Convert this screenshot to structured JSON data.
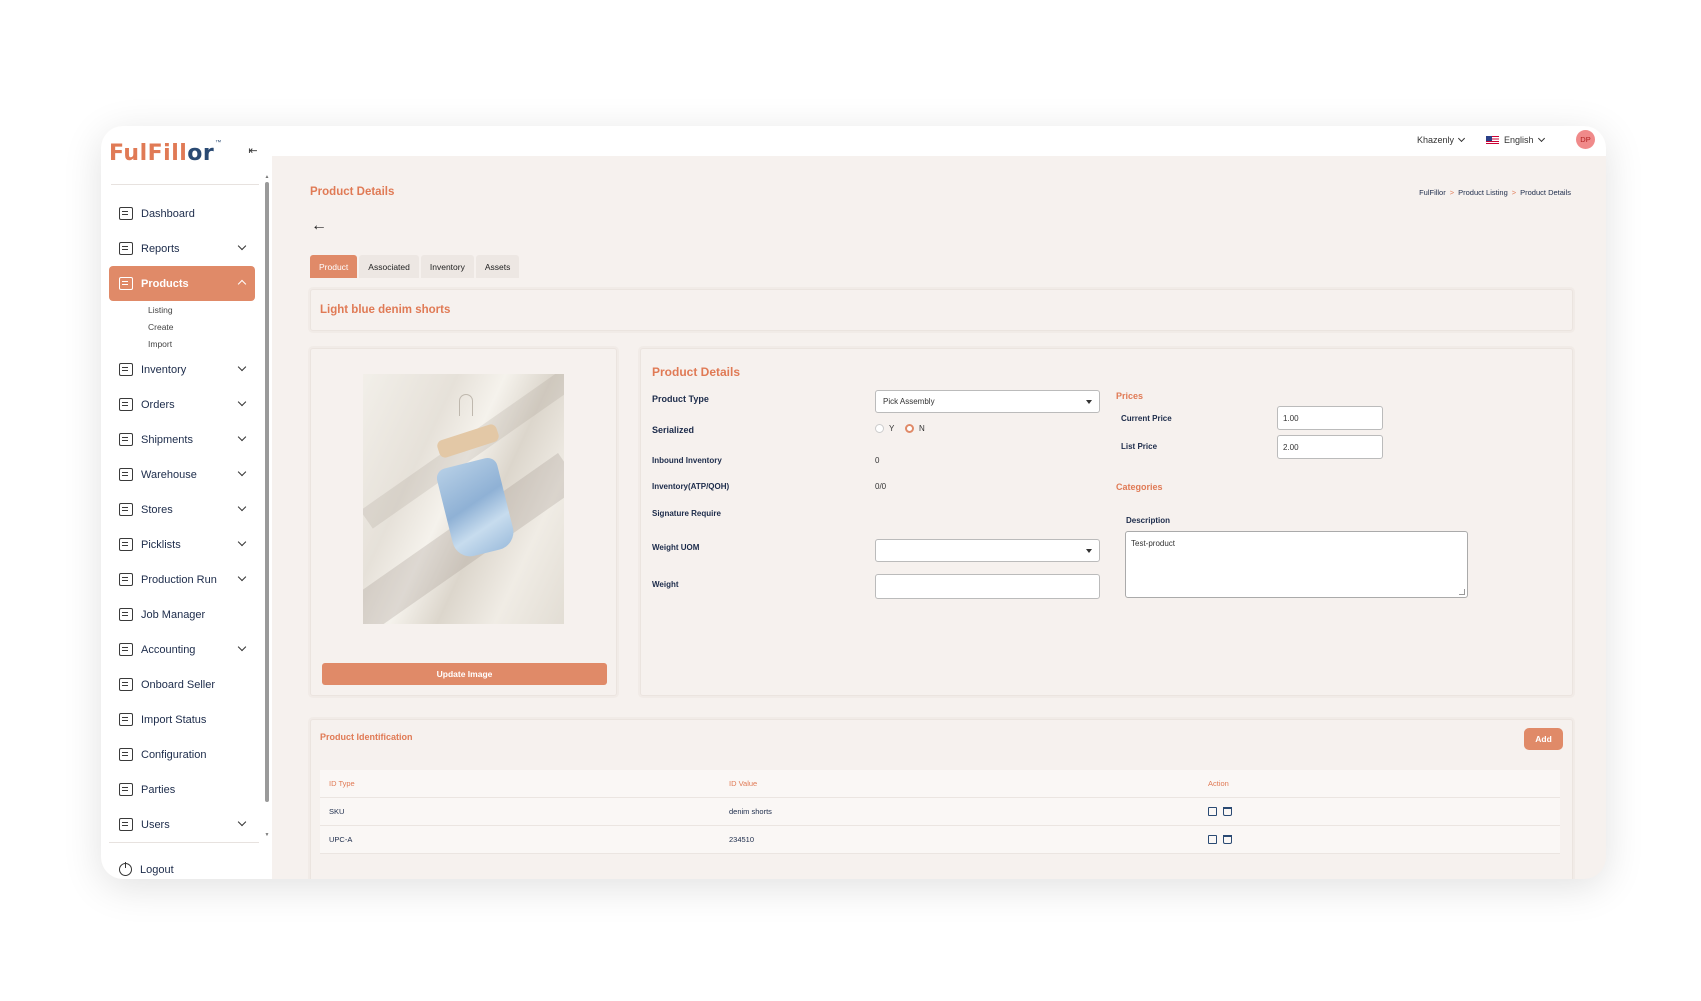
{
  "app": {
    "logo_main": "FulFill",
    "logo_accent": "or",
    "logo_mark": "™"
  },
  "sidebar": {
    "items": [
      {
        "label": "Dashboard",
        "icon": "dashboard-icon",
        "has_chevron": false
      },
      {
        "label": "Reports",
        "icon": "reports-icon",
        "has_chevron": true
      },
      {
        "label": "Products",
        "icon": "products-icon",
        "has_chevron": true,
        "active": true
      },
      {
        "label": "Inventory",
        "icon": "inventory-icon",
        "has_chevron": true
      },
      {
        "label": "Orders",
        "icon": "orders-icon",
        "has_chevron": true
      },
      {
        "label": "Shipments",
        "icon": "shipments-icon",
        "has_chevron": true
      },
      {
        "label": "Warehouse",
        "icon": "warehouse-icon",
        "has_chevron": true
      },
      {
        "label": "Stores",
        "icon": "stores-icon",
        "has_chevron": true
      },
      {
        "label": "Picklists",
        "icon": "picklists-icon",
        "has_chevron": true
      },
      {
        "label": "Production Run",
        "icon": "production-run-icon",
        "has_chevron": true
      },
      {
        "label": "Job Manager",
        "icon": "job-manager-icon",
        "has_chevron": false
      },
      {
        "label": "Accounting",
        "icon": "accounting-icon",
        "has_chevron": true
      },
      {
        "label": "Onboard Seller",
        "icon": "onboard-seller-icon",
        "has_chevron": false
      },
      {
        "label": "Import Status",
        "icon": "import-status-icon",
        "has_chevron": false
      },
      {
        "label": "Configuration",
        "icon": "configuration-icon",
        "has_chevron": false
      },
      {
        "label": "Parties",
        "icon": "parties-icon",
        "has_chevron": false
      },
      {
        "label": "Users",
        "icon": "users-icon",
        "has_chevron": true
      }
    ],
    "products_sub": [
      "Listing",
      "Create",
      "Import"
    ],
    "logout_label": "Logout"
  },
  "topbar": {
    "org": "Khazenly",
    "language": "English",
    "avatar_initials": "DP"
  },
  "page": {
    "title": "Product Details",
    "breadcrumb": [
      "FulFillor",
      "Product Listing",
      "Product Details"
    ],
    "breadcrumb_sep": ">",
    "back_arrow": "←"
  },
  "tabs": [
    "Product",
    "Associated",
    "Inventory",
    "Assets"
  ],
  "product_name": "Light blue denim shorts",
  "image_card": {
    "update_label": "Update Image"
  },
  "details": {
    "title": "Product Details",
    "product_type_label": "Product Type",
    "product_type_value": "Pick Assembly",
    "serialized_label": "Serialized",
    "serialized_options": [
      "Y",
      "N"
    ],
    "serialized_value": "N",
    "inbound_label": "Inbound Inventory",
    "inbound_value": "0",
    "atp_label": "Inventory(ATP/QOH)",
    "atp_value": "0/0",
    "signature_label": "Signature Require",
    "weight_uom_label": "Weight UOM",
    "weight_uom_value": "",
    "weight_label": "Weight",
    "weight_value": "",
    "prices_label": "Prices",
    "current_price_label": "Current Price",
    "current_price_value": "1.00",
    "list_price_label": "List Price",
    "list_price_value": "2.00",
    "categories_label": "Categories",
    "description_label": "Description",
    "description_value": "Test-product"
  },
  "identification": {
    "title": "Product Identification",
    "add_label": "Add",
    "columns": [
      "ID Type",
      "ID Value",
      "Action"
    ],
    "rows": [
      {
        "type": "SKU",
        "value": "denim shorts"
      },
      {
        "type": "UPC-A",
        "value": "234510"
      }
    ]
  },
  "colors": {
    "accent": "#e08a68",
    "accent_text": "#e07a55",
    "navy": "#1c2b4a",
    "background": "#f6f1ee"
  }
}
